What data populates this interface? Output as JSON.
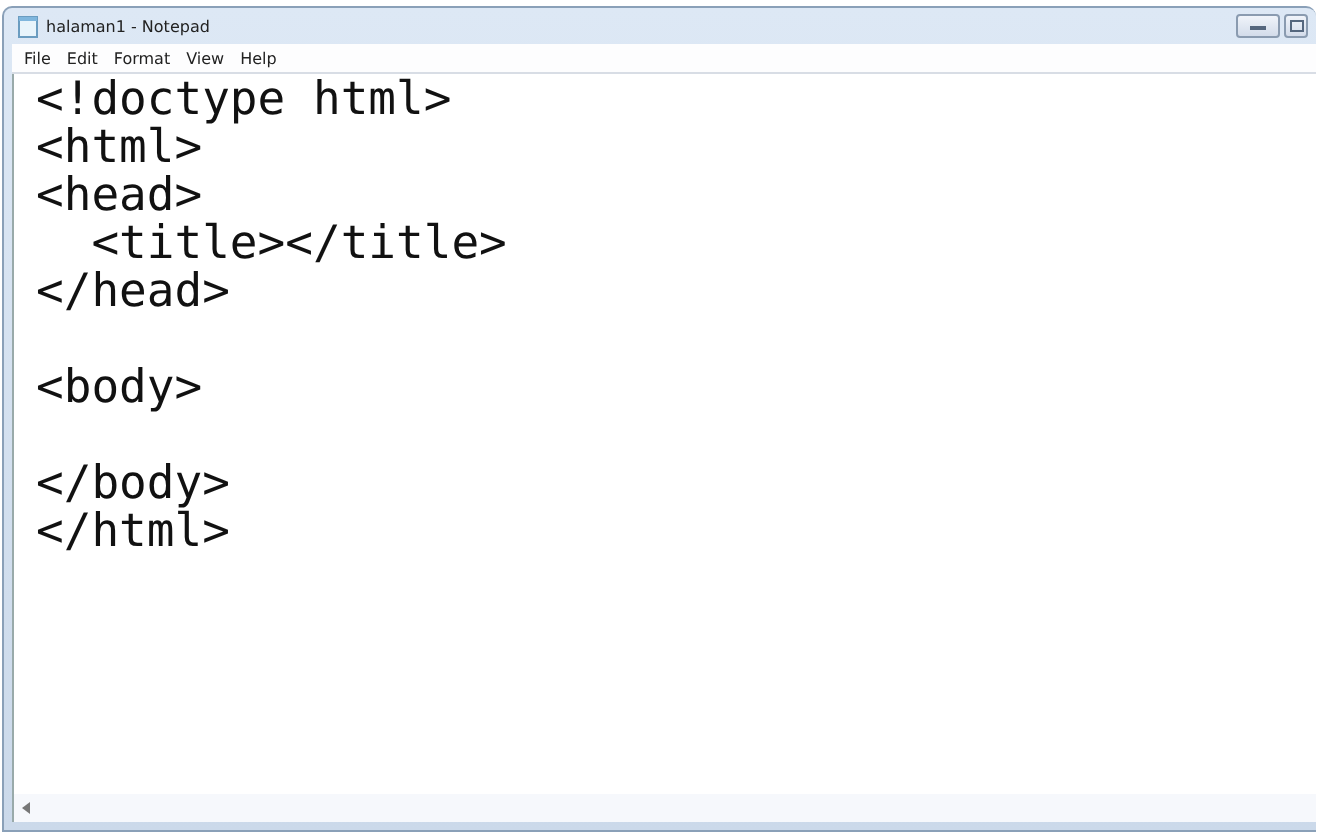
{
  "window": {
    "title": "halaman1 - Notepad"
  },
  "menu": [
    "File",
    "Edit",
    "Format",
    "View",
    "Help"
  ],
  "blocks": [
    [
      "<!doctype html>",
      "<html>",
      "<head>",
      "  <title></title>",
      "</head>"
    ],
    [
      "<body>"
    ],
    [
      "</body>",
      "</html>"
    ]
  ]
}
